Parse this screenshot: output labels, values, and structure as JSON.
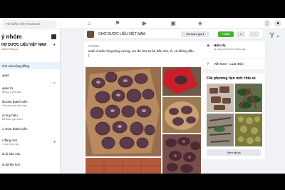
{
  "nav": {
    "search_placeholder": "Tìm kiếm trên Facebook",
    "menu_label": "⋮",
    "messenger_label": "●"
  },
  "sidebar": {
    "title": "ý nhóm",
    "group_name": "HỢ DƯỢC LIỆU VIỆT NAM",
    "group_meta": "Nhóm Riêng tư",
    "active_item": "chủ của cộng đồng",
    "items": [
      {
        "label": "quan",
        "sub": ""
      },
      {
        "label": "quản trị",
        "sub": "Riêng, 6 yêu cầu"
      },
      {
        "label": "ầu làm thành viên",
        "sub": "Yêu cầu mới hôm nay"
      },
      {
        "label": "ai huy hiệu",
        "sub": "Đã tham gia nhóm"
      },
      {
        "label": "ọ chọn thành viên",
        "sub": ""
      },
      {
        "label": "i đăng chờ",
        "sub": "1 mới hôm nay"
      },
      {
        "label": "ài bị báo cáo",
        "sub": ""
      },
      {
        "label": "ài đã lên lịch",
        "sub": ""
      }
    ]
  },
  "group_header": {
    "name": "CHỢ DƯỢC LIỆU VIỆT NAM",
    "joined_label": "Đã tham gia ▾",
    "invite_label": "+ Mời",
    "search_icon": "search-icon",
    "more_label": "···"
  },
  "post": {
    "top_line": "Có bán...",
    "text": "sanh chuẩn rừng tùng vương, em đủ size từ bé đến nhỏ, lô, cá không đầu ("
  },
  "right": {
    "about_title": "Hiển thị",
    "about_text": "Ai cũng có thể tìm nhóm này",
    "location_title": "Việt Nam - Luân Đôn",
    "media_title": "File phương tiện mới chia sẻ",
    "see_all": "Xem tất cả"
  },
  "colors": {
    "accent_green": "#42b72a",
    "link_blue": "#1877f2",
    "selected_bg": "#e7f3ff"
  }
}
